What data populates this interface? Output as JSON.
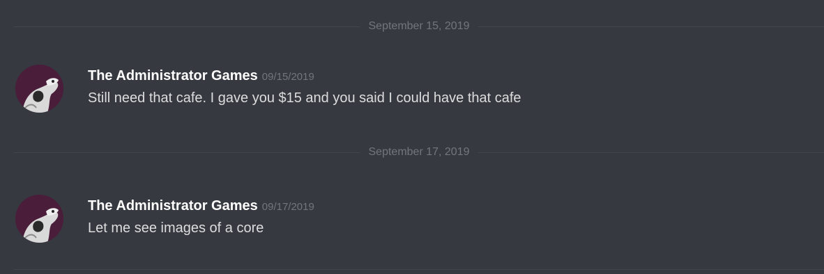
{
  "colors": {
    "background": "#36393f",
    "divider_line": "#42454a",
    "divider_text": "#72767d",
    "author": "#ffffff",
    "timestamp": "#72767d",
    "message_text": "#dcddde",
    "avatar_bg": "#4a1e3a"
  },
  "dividers": [
    {
      "label": "September 15, 2019"
    },
    {
      "label": "September 17, 2019"
    }
  ],
  "messages": [
    {
      "author": "The Administrator Games",
      "timestamp": "09/15/2019",
      "content": "Still need that cafe. I gave you $15 and you said I could have that cafe",
      "avatar_icon": "avatar-icon"
    },
    {
      "author": "The Administrator Games",
      "timestamp": "09/17/2019",
      "content": "Let me see images of a core",
      "avatar_icon": "avatar-icon"
    }
  ]
}
